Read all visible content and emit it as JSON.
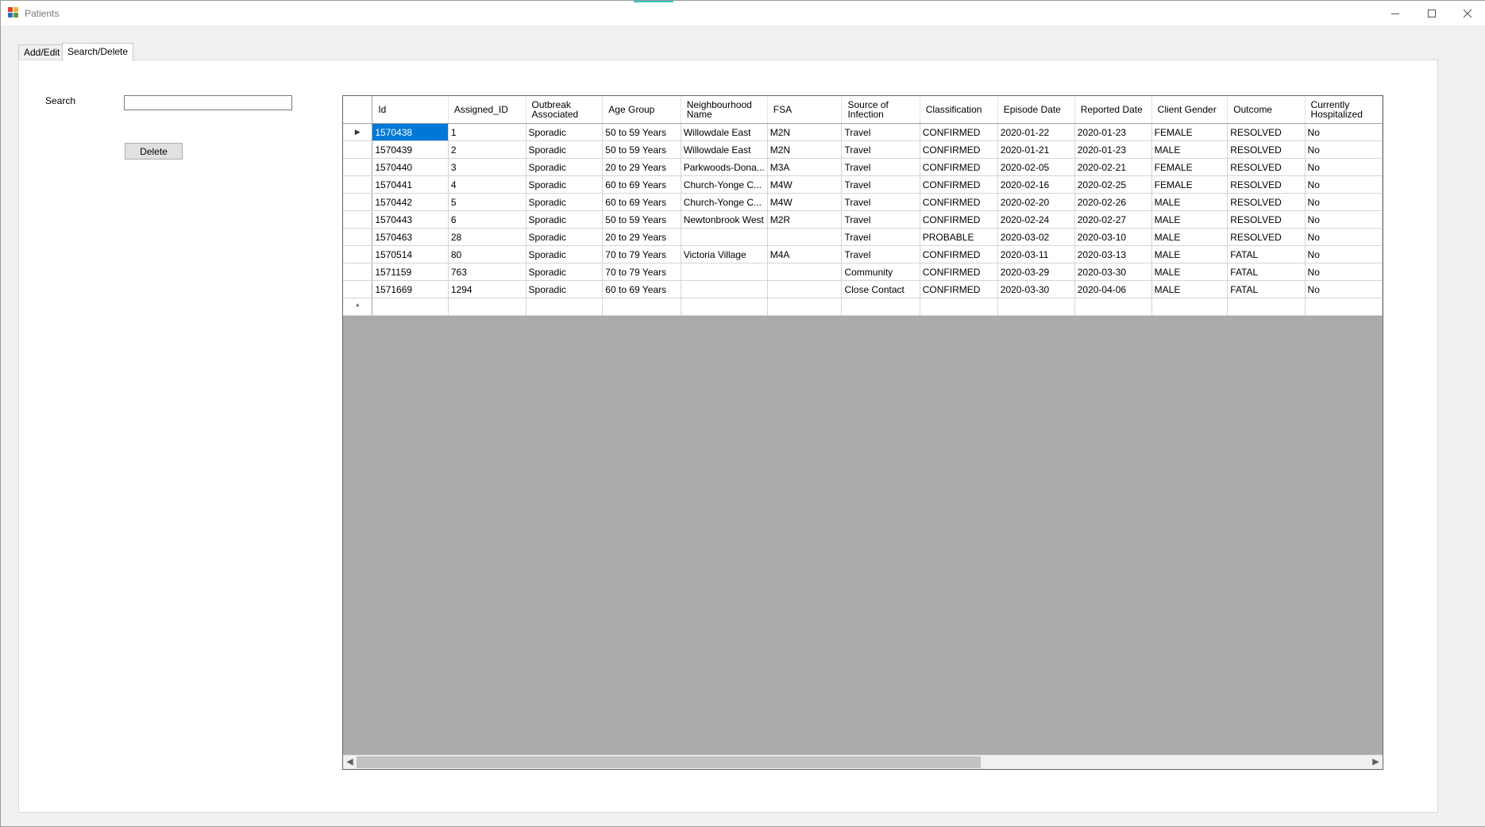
{
  "window": {
    "title": "Patients"
  },
  "tabs": [
    {
      "label": "Add/Edit",
      "active": false
    },
    {
      "label": "Search/Delete",
      "active": true
    }
  ],
  "search": {
    "label": "Search",
    "value": ""
  },
  "delete_button": {
    "label": "Delete"
  },
  "grid": {
    "columns": [
      "Id",
      "Assigned_ID",
      "Outbreak Associated",
      "Age Group",
      "Neighbourhood Name",
      "FSA",
      "Source of Infection",
      "Classification",
      "Episode Date",
      "Reported Date",
      "Client Gender",
      "Outcome",
      "Currently Hospitalized"
    ],
    "rows": [
      [
        "1570438",
        "1",
        "Sporadic",
        "50 to 59 Years",
        "Willowdale East",
        "M2N",
        "Travel",
        "CONFIRMED",
        "2020-01-22",
        "2020-01-23",
        "FEMALE",
        "RESOLVED",
        "No"
      ],
      [
        "1570439",
        "2",
        "Sporadic",
        "50 to 59 Years",
        "Willowdale East",
        "M2N",
        "Travel",
        "CONFIRMED",
        "2020-01-21",
        "2020-01-23",
        "MALE",
        "RESOLVED",
        "No"
      ],
      [
        "1570440",
        "3",
        "Sporadic",
        "20 to 29 Years",
        "Parkwoods-Dona...",
        "M3A",
        "Travel",
        "CONFIRMED",
        "2020-02-05",
        "2020-02-21",
        "FEMALE",
        "RESOLVED",
        "No"
      ],
      [
        "1570441",
        "4",
        "Sporadic",
        "60 to 69 Years",
        "Church-Yonge C...",
        "M4W",
        "Travel",
        "CONFIRMED",
        "2020-02-16",
        "2020-02-25",
        "FEMALE",
        "RESOLVED",
        "No"
      ],
      [
        "1570442",
        "5",
        "Sporadic",
        "60 to 69 Years",
        "Church-Yonge C...",
        "M4W",
        "Travel",
        "CONFIRMED",
        "2020-02-20",
        "2020-02-26",
        "MALE",
        "RESOLVED",
        "No"
      ],
      [
        "1570443",
        "6",
        "Sporadic",
        "50 to 59 Years",
        "Newtonbrook West",
        "M2R",
        "Travel",
        "CONFIRMED",
        "2020-02-24",
        "2020-02-27",
        "MALE",
        "RESOLVED",
        "No"
      ],
      [
        "1570463",
        "28",
        "Sporadic",
        "20 to 29 Years",
        "",
        "",
        "Travel",
        "PROBABLE",
        "2020-03-02",
        "2020-03-10",
        "MALE",
        "RESOLVED",
        "No"
      ],
      [
        "1570514",
        "80",
        "Sporadic",
        "70 to 79 Years",
        "Victoria Village",
        "M4A",
        "Travel",
        "CONFIRMED",
        "2020-03-11",
        "2020-03-13",
        "MALE",
        "FATAL",
        "No"
      ],
      [
        "1571159",
        "763",
        "Sporadic",
        "70 to 79 Years",
        "",
        "",
        "Community",
        "CONFIRMED",
        "2020-03-29",
        "2020-03-30",
        "MALE",
        "FATAL",
        "No"
      ],
      [
        "1571669",
        "1294",
        "Sporadic",
        "60 to 69 Years",
        "",
        "",
        "Close Contact",
        "CONFIRMED",
        "2020-03-30",
        "2020-04-06",
        "MALE",
        "FATAL",
        "No"
      ]
    ],
    "current_row_marker": "▶",
    "new_row_marker": "*"
  }
}
